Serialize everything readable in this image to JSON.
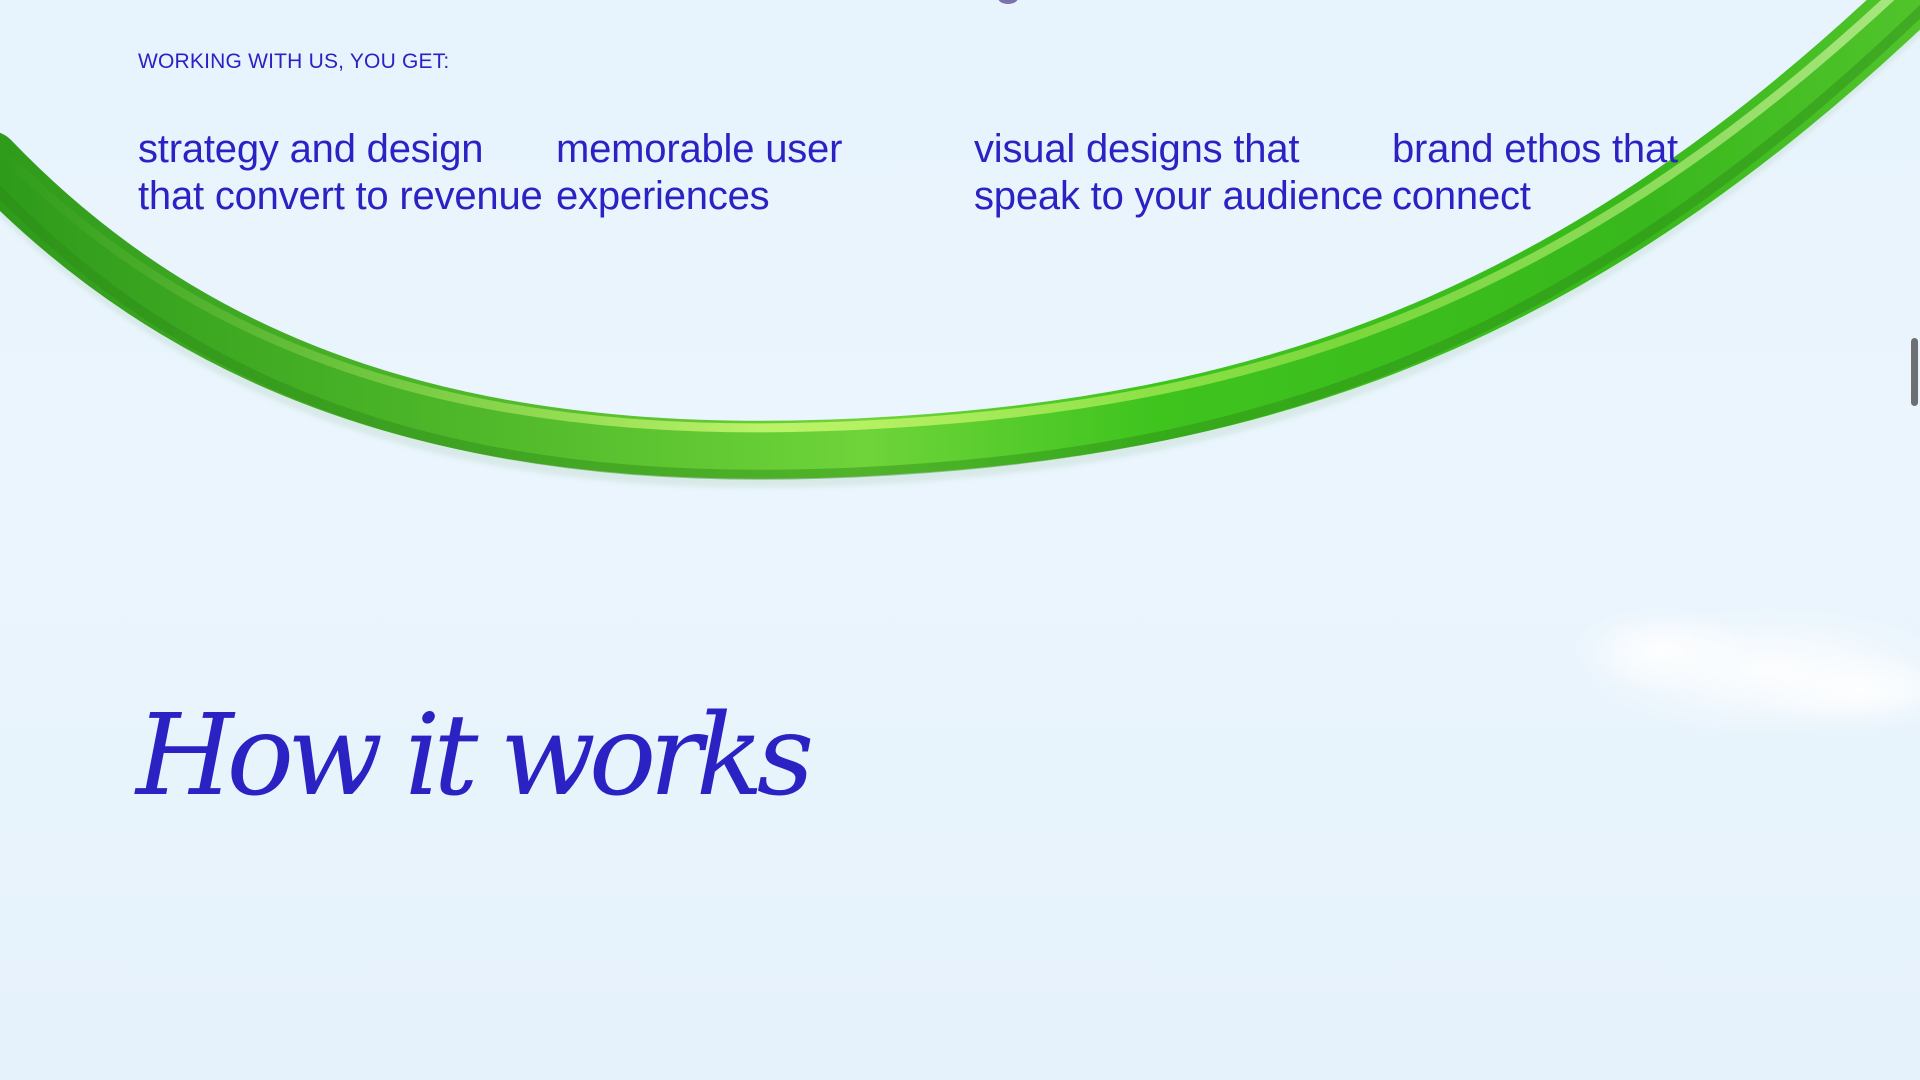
{
  "intro": {
    "eyebrow": "WORKING WITH US, YOU GET:"
  },
  "benefits": [
    "strategy and design that convert to revenue",
    "memorable user experiences",
    "visual designs that speak to your audience",
    "brand ethos that connect"
  ],
  "how_it_works": {
    "title": "How it works"
  },
  "colors": {
    "background": "#e8f4fd",
    "text_accent": "#2b22c4",
    "ring_green": "#3fb61e",
    "ring_highlight": "#b9f05a",
    "scrollbar_thumb": "#6e6f72"
  },
  "decorations": {
    "ring": "green-glass-ring-image",
    "cloud": "white-cloud-image"
  },
  "scroll": {
    "position": 0.31
  }
}
